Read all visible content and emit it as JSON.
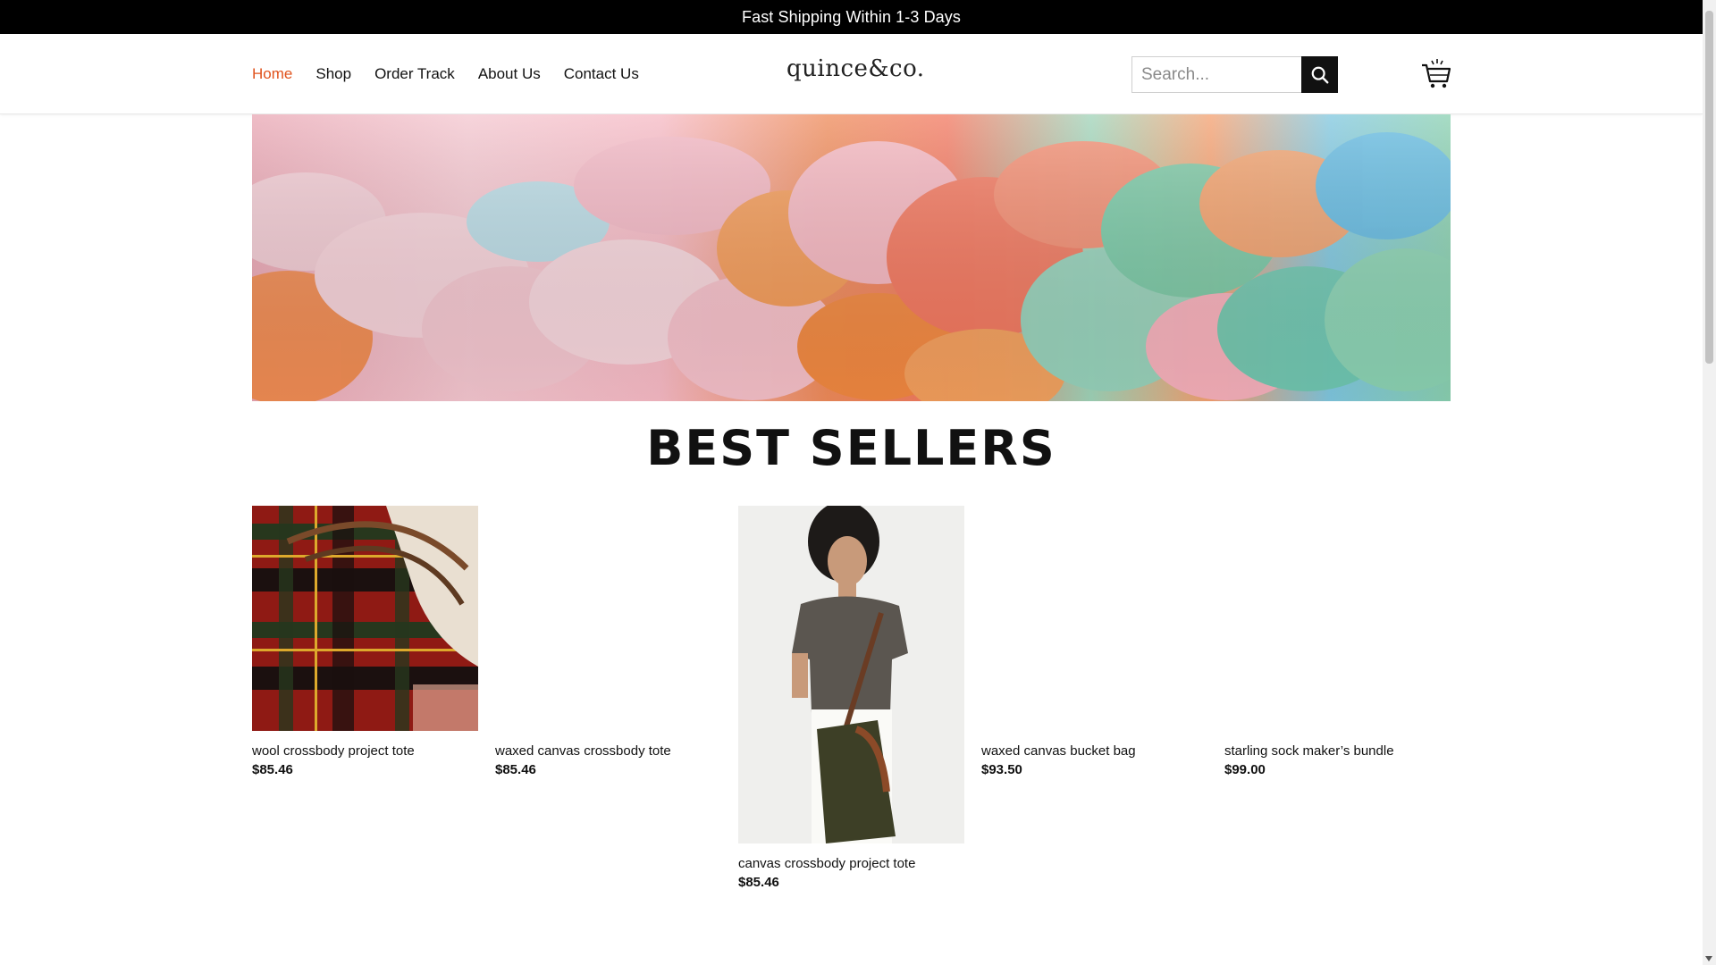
{
  "announcement": "Fast Shipping Within 1-3 Days",
  "nav": {
    "items": [
      {
        "label": "Home",
        "active": true
      },
      {
        "label": "Shop",
        "active": false
      },
      {
        "label": "Order Track",
        "active": false
      },
      {
        "label": "About Us",
        "active": false
      },
      {
        "label": "Contact Us",
        "active": false
      }
    ]
  },
  "logo": "quince&co.",
  "search": {
    "placeholder": "Search...",
    "value": ""
  },
  "icons": {
    "search": "search-icon",
    "cart": "shopping-cart-icon"
  },
  "colors": {
    "accent": "#e0531d",
    "topbar": "#000000"
  },
  "section_title": "BEST SELLERS",
  "products": [
    {
      "name": "wool crossbody project tote",
      "price": "$85.46"
    },
    {
      "name": "waxed canvas crossbody tote",
      "price": "$85.46"
    },
    {
      "name": "canvas crossbody project tote",
      "price": "$85.46"
    },
    {
      "name": "waxed canvas bucket bag",
      "price": "$93.50"
    },
    {
      "name": "starling sock maker’s bundle",
      "price": "$99.00"
    }
  ]
}
